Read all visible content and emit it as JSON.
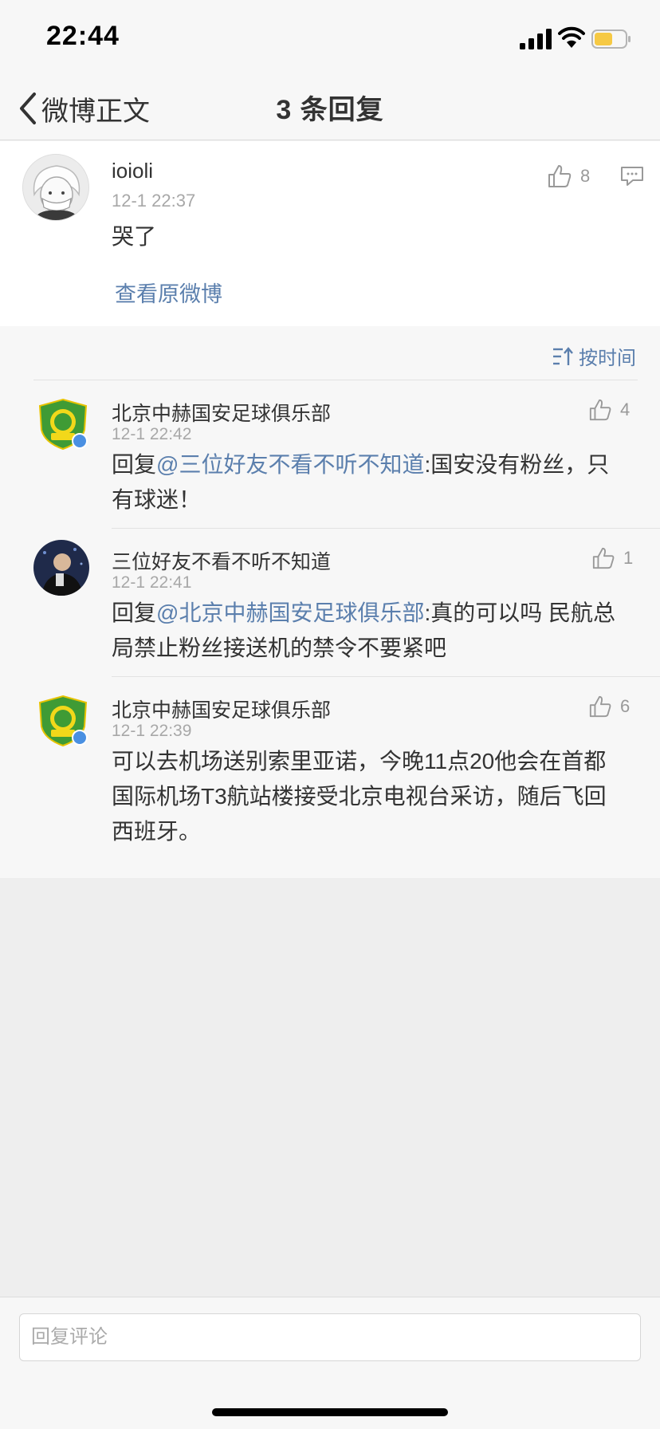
{
  "status_bar": {
    "time": "22:44"
  },
  "nav": {
    "back_label": "微博正文",
    "title": "3 条回复"
  },
  "main_comment": {
    "username": "ioioli",
    "time": "12-1 22:37",
    "text": "哭了",
    "likes": "8",
    "view_original": "查看原微博"
  },
  "sort": {
    "label": "按时间"
  },
  "replies": [
    {
      "username": "北京中赫国安足球俱乐部",
      "time": "12-1 22:42",
      "prefix": "回复",
      "mention": "@三位好友不看不听不知道",
      "line1_rest": ":国安没有粉丝，只",
      "line2": "有球迷！",
      "likes": "4"
    },
    {
      "username": "三位好友不看不听不知道",
      "time": "12-1 22:41",
      "prefix": "回复",
      "mention": "@北京中赫国安足球俱乐部",
      "line1_rest": ":真的可以吗 民航总",
      "line2": "局禁止粉丝接送机的禁令不要紧吧",
      "likes": "1"
    },
    {
      "username": "北京中赫国安足球俱乐部",
      "time": "12-1 22:39",
      "line1": "可以去机场送别索里亚诺，今晚11点20他会在首都",
      "line2": "国际机场T3航站楼接受北京电视台采访，随后飞回",
      "line3": "西班牙。",
      "likes": "6"
    }
  ],
  "bottom": {
    "placeholder": "回复评论"
  },
  "colors": {
    "link": "#5b7fad",
    "club_green": "#3f9b35",
    "verified": "#4a90e2"
  },
  "icons": [
    "back-chevron-icon",
    "thumbs-up-icon",
    "comment-icon",
    "sort-time-icon",
    "verified-badge-icon",
    "signal-icon",
    "wifi-icon",
    "battery-icon"
  ]
}
